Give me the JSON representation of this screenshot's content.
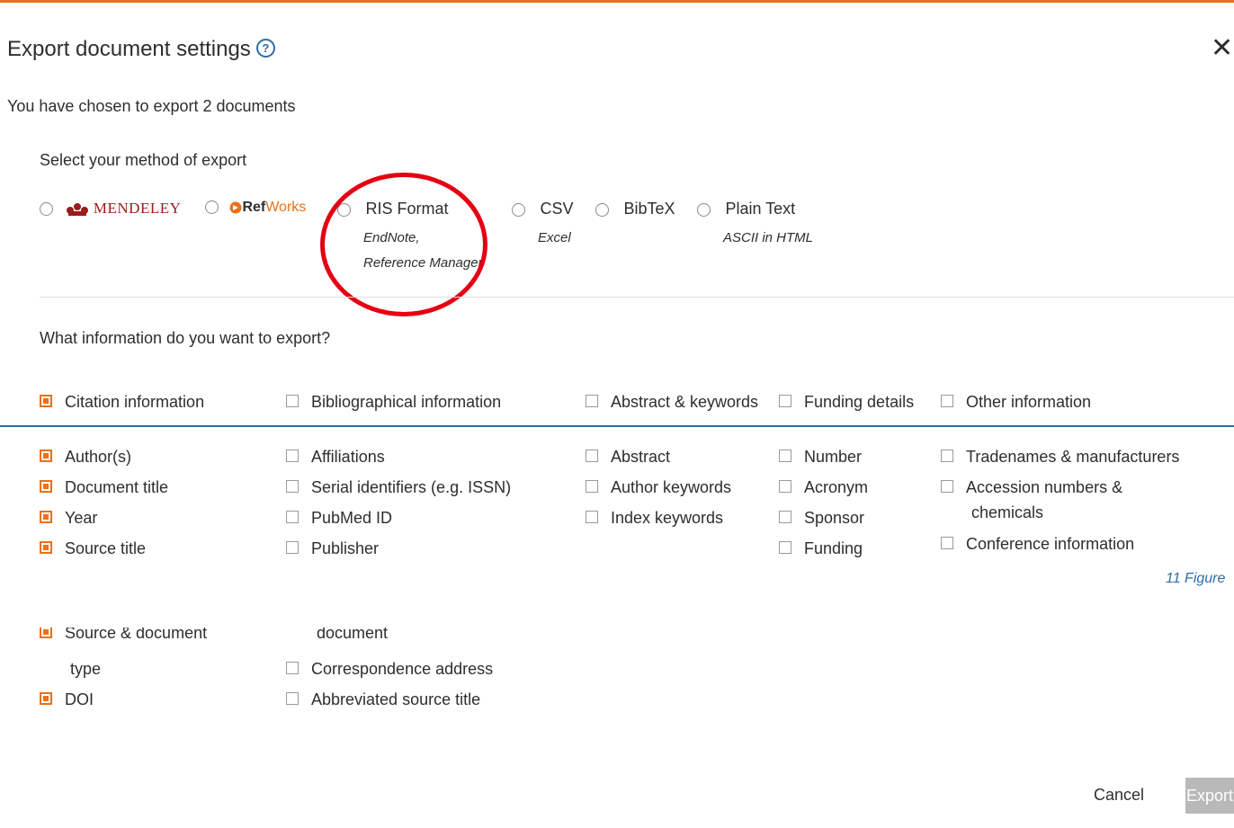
{
  "dialog": {
    "title": "Export document settings",
    "help_icon": "?",
    "close_icon": "✕",
    "chosen_text": "You have chosen to export 2 documents",
    "method_heading": "Select your method of export",
    "methods": [
      {
        "label": "MENDELEY",
        "icon": "mendeley-logo-icon"
      },
      {
        "label_bold": "Ref",
        "label_colored": "Works",
        "icon": "refworks-logo-icon"
      },
      {
        "label": "RIS Format",
        "sub1": "EndNote,",
        "sub2": "Reference Manager"
      },
      {
        "label": "CSV",
        "sub1": "Excel"
      },
      {
        "label": "BibTeX"
      },
      {
        "label": "Plain Text",
        "sub1": "ASCII in HTML"
      }
    ],
    "info_heading": "What information do you want to export?",
    "categories": [
      {
        "label": "Citation information",
        "checked": true
      },
      {
        "label": "Bibliographical information",
        "checked": false
      },
      {
        "label": "Abstract & keywords",
        "checked": false
      },
      {
        "label": "Funding details",
        "checked": false
      },
      {
        "label": "Other information",
        "checked": false
      }
    ],
    "citation_fields": [
      "Author(s)",
      "Document title",
      "Year",
      "Source title"
    ],
    "biblio_fields": [
      "Affiliations",
      "Serial identifiers (e.g. ISSN)",
      "PubMed ID",
      "Publisher"
    ],
    "abstract_fields": [
      "Abstract",
      "Author keywords",
      "Index keywords"
    ],
    "funding_fields": [
      "Number",
      "Acronym",
      "Sponsor",
      "Funding"
    ],
    "other_fields": [
      "Tradenames & manufacturers",
      "Accession numbers &",
      "chemicals",
      "Conference information"
    ],
    "figure_label": "11 Figure",
    "lower_citation": [
      "Source & document",
      "type",
      "DOI"
    ],
    "lower_biblio": [
      "document",
      "Correspondence address",
      "Abbreviated source title"
    ],
    "cancel_label": "Cancel",
    "export_label": "Export"
  },
  "colors": {
    "accent": "#e9711c",
    "link_blue": "#2e6da4",
    "annotation_red": "#e40012",
    "disabled_button": "#b9b9b9"
  }
}
